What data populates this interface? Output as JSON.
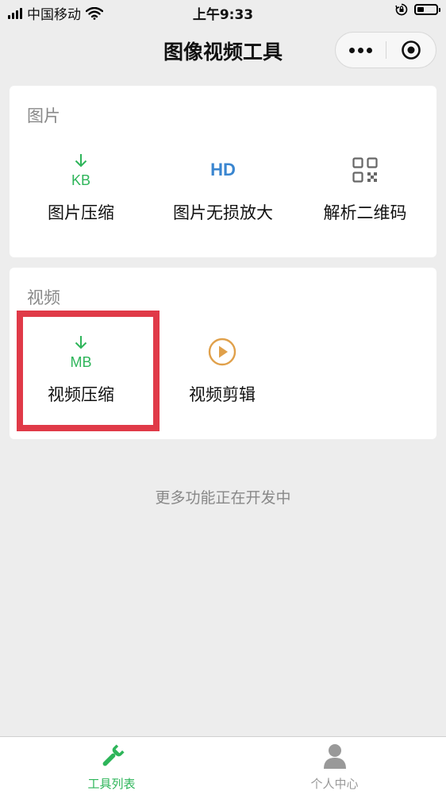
{
  "status_bar": {
    "carrier": "中国移动",
    "time": "上午9:33"
  },
  "nav": {
    "title": "图像视频工具"
  },
  "image_section": {
    "title": "图片",
    "tools": [
      {
        "label": "图片压缩",
        "icon": "kb-download-icon",
        "icon_text": "KB",
        "color": "#2eb55a"
      },
      {
        "label": "图片无损放大",
        "icon": "hd-icon",
        "icon_text": "HD",
        "color": "#3a86d0"
      },
      {
        "label": "解析二维码",
        "icon": "qr-code-icon",
        "color": "#666666"
      }
    ]
  },
  "video_section": {
    "title": "视频",
    "tools": [
      {
        "label": "视频压缩",
        "icon": "mb-download-icon",
        "icon_text": "MB",
        "color": "#2eb55a"
      },
      {
        "label": "视频剪辑",
        "icon": "play-circle-icon",
        "color": "#e0a04a"
      }
    ]
  },
  "more_note": "更多功能正在开发中",
  "tab_bar": {
    "tabs": [
      {
        "label": "工具列表",
        "icon": "wrench-icon",
        "active": true,
        "color": "#2eb55a"
      },
      {
        "label": "个人中心",
        "icon": "person-icon",
        "active": false,
        "color": "#999999"
      }
    ]
  },
  "colors": {
    "highlight": "#e03a48",
    "background": "#ededed",
    "accent": "#2eb55a"
  }
}
